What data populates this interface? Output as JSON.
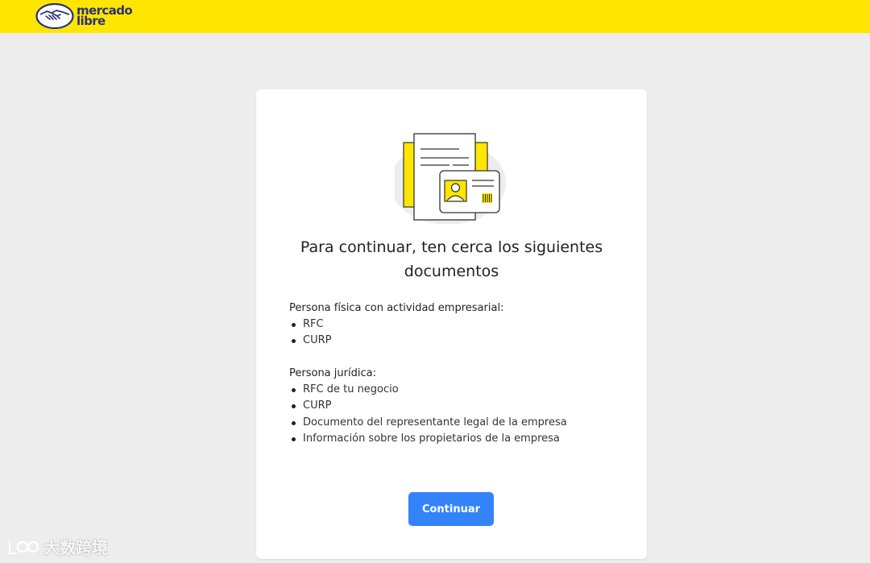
{
  "header": {
    "logo_line1": "mercado",
    "logo_line2": "libre",
    "brand_color": "#ffe600"
  },
  "main": {
    "illustration_icon": "documents-id-card-illustration",
    "title_line1": "Para continuar, ten cerca los siguientes",
    "title_line2": "documentos",
    "sections": [
      {
        "heading": "Persona física con actividad empresarial:",
        "items": [
          "RFC",
          "CURP"
        ]
      },
      {
        "heading": "Persona jurídica:",
        "items": [
          "RFC de tu negocio",
          "CURP",
          "Documento del representante legal de la empresa",
          "Información sobre los propietarios de la empresa"
        ]
      }
    ],
    "continue_label": "Continuar",
    "button_color": "#3483fa"
  },
  "watermark": {
    "text": "大数跨境"
  }
}
